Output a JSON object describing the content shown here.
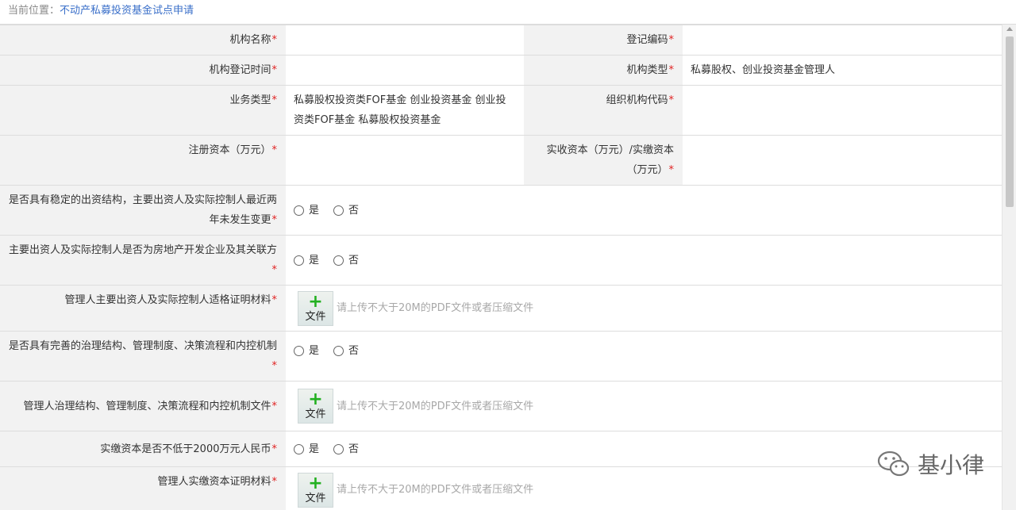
{
  "breadcrumb": {
    "label": "当前位置：",
    "current": "不动产私募投资基金试点申请"
  },
  "required_mark": "*",
  "rows": {
    "org_name": {
      "label": "机构名称"
    },
    "reg_code": {
      "label": "登记编码"
    },
    "reg_time": {
      "label": "机构登记时间"
    },
    "org_type": {
      "label": "机构类型",
      "value": "私募股权、创业投资基金管理人"
    },
    "biz_type": {
      "label": "业务类型",
      "value": "私募股权投资类FOF基金 创业投资基金 创业投资类FOF基金 私募股权投资基金"
    },
    "org_code": {
      "label": "组织机构代码"
    },
    "reg_capital": {
      "label": "注册资本（万元）"
    },
    "paid_capital": {
      "label": "实收资本（万元）/实缴资本（万元）"
    },
    "stable_structure": {
      "label": "是否具有稳定的出资结构，主要出资人及实际控制人最近两年未发生变更"
    },
    "real_estate": {
      "label": "主要出资人及实际控制人是否为房地产开发企业及其关联方"
    },
    "qual_material": {
      "label": "管理人主要出资人及实际控制人适格证明材料"
    },
    "governance": {
      "label": "是否具有完善的治理结构、管理制度、决策流程和内控机制"
    },
    "governance_file": {
      "label": "管理人治理结构、管理制度、决策流程和内控机制文件"
    },
    "paid_2000": {
      "label": "实缴资本是否不低于2000万元人民币"
    },
    "paid_proof": {
      "label": "管理人实缴资本证明材料"
    }
  },
  "radio": {
    "yes": "是",
    "no": "否"
  },
  "upload": {
    "button": "文件",
    "hint": "请上传不大于20M的PDF文件或者压缩文件"
  },
  "watermark": "基小律",
  "colors": {
    "required": "#e02020",
    "breadcrumb_link": "#3a6fc9",
    "label_bg": "#f2f2f2",
    "upload_plus": "#22b020"
  }
}
